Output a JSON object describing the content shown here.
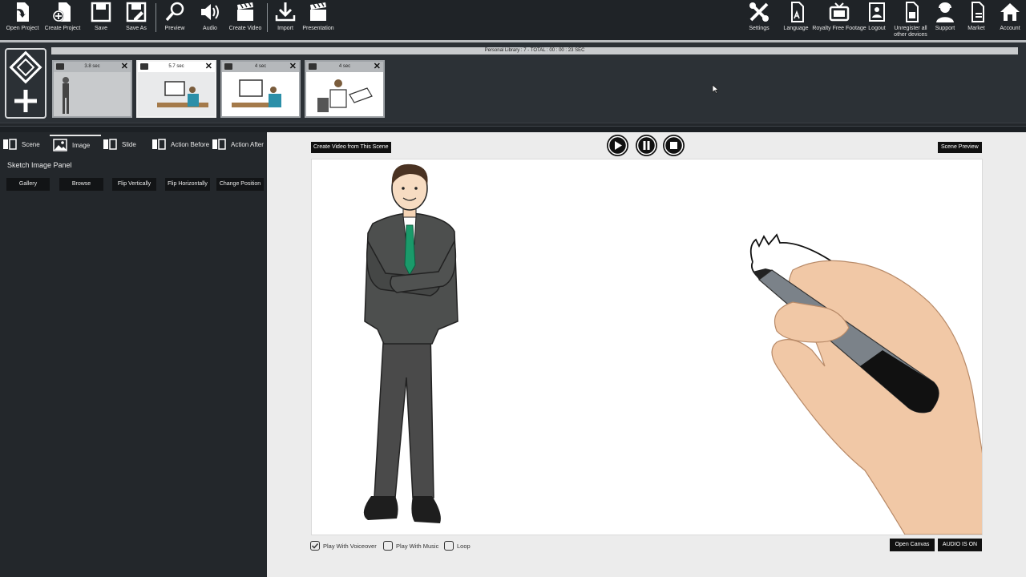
{
  "toolbar": {
    "left": [
      {
        "label": "Open Project",
        "icon": "open-project-icon"
      },
      {
        "label": "Create Project",
        "icon": "create-project-icon"
      },
      {
        "label": "Save",
        "icon": "save-icon"
      },
      {
        "label": "Save As",
        "icon": "save-as-icon"
      },
      {
        "label": "Preview",
        "icon": "preview-icon"
      },
      {
        "label": "Audio",
        "icon": "audio-icon"
      },
      {
        "label": "Create Video",
        "icon": "create-video-icon"
      },
      {
        "label": "Import",
        "icon": "import-icon"
      },
      {
        "label": "Presentation",
        "icon": "presentation-icon"
      }
    ],
    "right": [
      {
        "label": "Settings",
        "icon": "settings-icon"
      },
      {
        "label": "Language",
        "icon": "language-icon"
      },
      {
        "label": "Royalty Free Footage",
        "icon": "footage-icon"
      },
      {
        "label": "Logout",
        "icon": "logout-icon"
      },
      {
        "label": "Unregister all other devices",
        "icon": "unregister-icon"
      },
      {
        "label": "Support",
        "icon": "support-icon"
      },
      {
        "label": "Market",
        "icon": "market-icon"
      },
      {
        "label": "Account",
        "icon": "account-icon"
      }
    ]
  },
  "library": {
    "summary": "Personal Library : 7 - TOTAL : 00 : 00 : 23 SEC"
  },
  "scenes": [
    {
      "duration": "3.8 sec"
    },
    {
      "duration": "5.7 sec"
    },
    {
      "duration": "4 sec"
    },
    {
      "duration": "4 sec"
    }
  ],
  "tabs": [
    "Scene",
    "Image",
    "Slide",
    "Action Before",
    "Action After"
  ],
  "panel": {
    "title": "Sketch Image Panel",
    "buttons": [
      "Gallery",
      "Browse",
      "Flip Vertically",
      "Flip Horizontally",
      "Change Position"
    ]
  },
  "canvas": {
    "create_video": "Create Video from This Scene",
    "scene_preview": "Scene Preview",
    "open_canvas": "Open Canvas",
    "audio": "AUDIO IS ON",
    "options": [
      {
        "label": "Play With Voiceover",
        "checked": true
      },
      {
        "label": "Play With Music",
        "checked": false
      },
      {
        "label": "Loop",
        "checked": false
      }
    ]
  },
  "colors": {
    "toolbar_bg": "#1f2327",
    "panel_bg": "#23272b",
    "canvas_bg": "#ececec",
    "tie": "#1a9a6a"
  }
}
